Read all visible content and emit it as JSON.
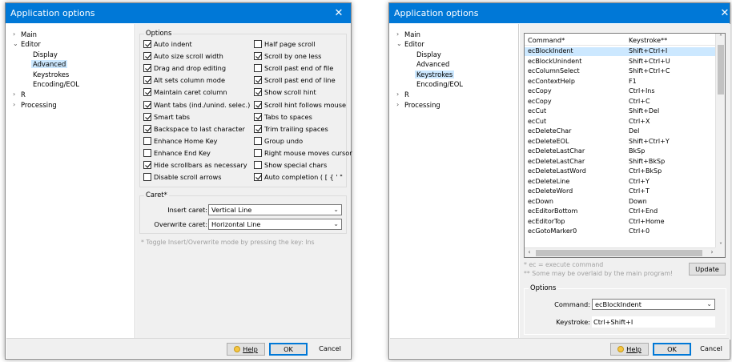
{
  "colors": {
    "titlebar": "#0078d7",
    "selection": "#cce8ff",
    "panel": "#f0f0f0"
  },
  "window_left": {
    "title": "Application options",
    "tree": {
      "main": "Main",
      "editor": "Editor",
      "display": "Display",
      "advanced": "Advanced",
      "keystrokes": "Keystrokes",
      "encoding": "Encoding/EOL",
      "r": "R",
      "processing": "Processing"
    },
    "options_title": "Options",
    "options_left": [
      {
        "label": "Auto indent",
        "checked": true
      },
      {
        "label": "Auto size scroll width",
        "checked": true
      },
      {
        "label": "Drag and drop editing",
        "checked": true
      },
      {
        "label": "Alt sets column mode",
        "checked": true
      },
      {
        "label": "Maintain caret column",
        "checked": true
      },
      {
        "label": "Want tabs (ind./unind. selec.)",
        "checked": true
      },
      {
        "label": "Smart tabs",
        "checked": true
      },
      {
        "label": "Backspace to last character",
        "checked": true
      },
      {
        "label": "Enhance Home Key",
        "checked": false
      },
      {
        "label": "Enhance End Key",
        "checked": false
      },
      {
        "label": "Hide scrollbars as necessary",
        "checked": true
      },
      {
        "label": "Disable scroll arrows",
        "checked": false
      }
    ],
    "options_right": [
      {
        "label": "Half page scroll",
        "checked": false
      },
      {
        "label": "Scroll by one less",
        "checked": true
      },
      {
        "label": "Scroll past end of file",
        "checked": false
      },
      {
        "label": "Scroll past end of line",
        "checked": true
      },
      {
        "label": "Show scroll hint",
        "checked": true
      },
      {
        "label": "Scroll hint follows mouse",
        "checked": true
      },
      {
        "label": "Tabs to spaces",
        "checked": true
      },
      {
        "label": "Trim trailing spaces",
        "checked": true
      },
      {
        "label": "Group undo",
        "checked": false
      },
      {
        "label": "Right mouse moves cursor",
        "checked": false
      },
      {
        "label": "Show special chars",
        "checked": false
      },
      {
        "label": "Auto completion ( [ { ' \"",
        "checked": true
      }
    ],
    "caret_title": "Caret*",
    "insert_caret_label": "Insert caret:",
    "insert_caret_value": "Vertical Line",
    "overwrite_caret_label": "Overwrite caret:",
    "overwrite_caret_value": "Horizontal Line",
    "hint": "* Toggle Insert/Overwrite mode by pressing the key: Ins",
    "help_label": "Help",
    "ok_label": "OK",
    "cancel_label": "Cancel"
  },
  "window_right": {
    "title": "Application options",
    "col_command": "Command*",
    "col_keystroke": "Keystroke**",
    "rows": [
      {
        "command": "ecBlockIndent",
        "keystroke": "Shift+Ctrl+I"
      },
      {
        "command": "ecBlockUnindent",
        "keystroke": "Shift+Ctrl+U"
      },
      {
        "command": "ecColumnSelect",
        "keystroke": "Shift+Ctrl+C"
      },
      {
        "command": "ecContextHelp",
        "keystroke": "F1"
      },
      {
        "command": "ecCopy",
        "keystroke": "Ctrl+Ins"
      },
      {
        "command": "ecCopy",
        "keystroke": "Ctrl+C"
      },
      {
        "command": "ecCut",
        "keystroke": "Shift+Del"
      },
      {
        "command": "ecCut",
        "keystroke": "Ctrl+X"
      },
      {
        "command": "ecDeleteChar",
        "keystroke": "Del"
      },
      {
        "command": "ecDeleteEOL",
        "keystroke": "Shift+Ctrl+Y"
      },
      {
        "command": "ecDeleteLastChar",
        "keystroke": "BkSp"
      },
      {
        "command": "ecDeleteLastChar",
        "keystroke": "Shift+BkSp"
      },
      {
        "command": "ecDeleteLastWord",
        "keystroke": "Ctrl+BkSp"
      },
      {
        "command": "ecDeleteLine",
        "keystroke": "Ctrl+Y"
      },
      {
        "command": "ecDeleteWord",
        "keystroke": "Ctrl+T"
      },
      {
        "command": "ecDown",
        "keystroke": "Down"
      },
      {
        "command": "ecEditorBottom",
        "keystroke": "Ctrl+End"
      },
      {
        "command": "ecEditorTop",
        "keystroke": "Ctrl+Home"
      },
      {
        "command": "ecGotoMarker0",
        "keystroke": "Ctrl+0"
      }
    ],
    "note1": "*  ec = execute command",
    "note2": "** Some may be overlaid by the main program!",
    "update_label": "Update",
    "options_title": "Options",
    "command_label": "Command:",
    "command_value": "ecBlockIndent",
    "keystroke_label": "Keystroke:",
    "keystroke_value": "Ctrl+Shift+I",
    "help_label": "Help",
    "ok_label": "OK",
    "cancel_label": "Cancel"
  }
}
